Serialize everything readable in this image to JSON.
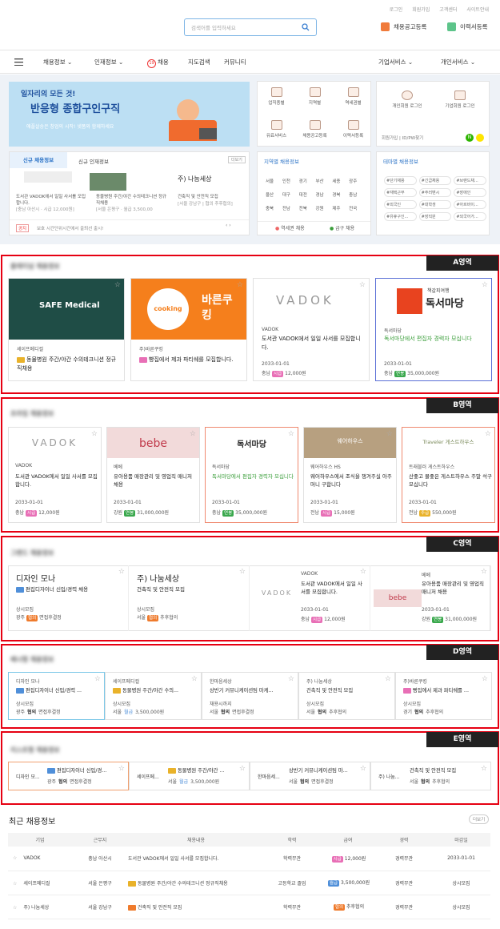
{
  "top_links": [
    "로그인",
    "회원가입",
    "고객센터",
    "사이트안내"
  ],
  "search": {
    "placeholder": "검색어를 입력하세요"
  },
  "header": {
    "post_job": "채용공고등록",
    "post_resume": "이력서등록"
  },
  "nav": {
    "items": [
      "채용정보",
      "인재정보",
      "채용",
      "지도검색",
      "커뮤니티"
    ],
    "badge": "19",
    "right": [
      "기업서비스",
      "개인서비스"
    ]
  },
  "banner": {
    "line1": "일자리의 모든 것!",
    "line2": "반응형 종합구인구직",
    "line3": "애플살송은 창업의 시작! 넷폼와 함께하세요"
  },
  "tiles": [
    "업직종별",
    "지역별",
    "역세권별",
    "유료서비스",
    "채용공고등록",
    "이력서등록"
  ],
  "login": {
    "personal": "개인회원 로그인",
    "company": "기업회원 로그인",
    "join": "회원가입",
    "find": "ID/PW찾기"
  },
  "new_info": {
    "tab1": "신규 채용정보",
    "tab2": "신규 인재정보",
    "more": "더보기",
    "items": [
      {
        "desc": "도서관 VADOK에서 일일 사서를 모집합니다.",
        "meta": "[충남 아산시 · 시급 12,000원]"
      },
      {
        "desc": "동물병원 주간/야간 수의테크니션 정규직채용",
        "meta": "[서울 은평구 · 월급 3,500,00"
      },
      {
        "name": "주) 나눔세상",
        "desc": "건축직 및 안전직 모집",
        "meta": "[서울 강남구 | 협의 추후협의]"
      }
    ],
    "notice_label": "공지",
    "notice": "보호 시간단위시간에서 출퇴선 출시!"
  },
  "region": {
    "title": "지역별 채용정보",
    "cities": [
      "서울",
      "인천",
      "경기",
      "부산",
      "세종",
      "광주",
      "울산",
      "대구",
      "대전",
      "경남",
      "경북",
      "충남",
      "충북",
      "전남",
      "전북",
      "강원",
      "제주",
      "전국"
    ],
    "subway": "역세권 채용",
    "urgent": "급구 채용"
  },
  "theme": {
    "title": "테마별 채용정보",
    "tags": [
      "#단기채용",
      "#긴급채용",
      "#브랜드채...",
      "#재택근무",
      "#주러벤시",
      "#장애인",
      "#외국인",
      "#대학생",
      "#아르바이...",
      "#유휴구인...",
      "#장직원",
      "#외국어가..."
    ]
  },
  "section_a": {
    "tag": "A영역",
    "title": "플래티넘 채용정보",
    "cards": [
      {
        "logo": "SAFE Medical",
        "company": "세이프메디컬",
        "title": "동물병원 주간/야간 수의테크니션 정규직채용"
      },
      {
        "logo": "cooking",
        "logo2": "바른쿠킹",
        "company": "주)바른쿠킹",
        "title": "빵집에서 제과 파티쉐를 모집합니다."
      },
      {
        "logo": "VADOK",
        "company": "VADOK",
        "title": "도서관 VADOK에서 일일 사서를 모집합니다.",
        "date": "2033-01-01",
        "region": "충남",
        "pay_type": "시급",
        "pay": "12,000원"
      },
      {
        "logo": "독서마당",
        "logo_small": "책갈피여행",
        "company": "독서마당",
        "title": "독서마당에서 편집자 경력자 모십니다",
        "date": "2033-01-01",
        "region": "충남",
        "pay_type": "연봉",
        "pay": "35,000,000원"
      }
    ]
  },
  "section_b": {
    "tag": "B영역",
    "title": "프라임 채용정보",
    "cards": [
      {
        "logo": "VADOK",
        "company": "VADOK",
        "title": "도서관 VADOK에서 일일 사서를 모집합니다.",
        "date": "2033-01-01",
        "region": "충남",
        "pay_type": "시급",
        "pay": "12,000원"
      },
      {
        "logo": "bebe",
        "company": "베베",
        "title": "유아용품 매장관리 및 영업직 매니저 채용",
        "date": "2033-01-01",
        "region": "강원",
        "pay_type": "연봉",
        "pay": "31,000,000원"
      },
      {
        "logo": "독서마당",
        "company": "독서마당",
        "title": "독서마당에서 편집자 경력자 모십니다",
        "date": "2033-01-01",
        "region": "충남",
        "pay_type": "연봉",
        "pay": "35,000,000원"
      },
      {
        "logo": "웨어하우스",
        "company": "웨어하우스 HS",
        "title": "웨어하우스에서 조식을 챙겨주실 아주머니 구합니다",
        "date": "2033-01-01",
        "region": "전남",
        "pay_type": "시급",
        "pay": "15,000원"
      },
      {
        "logo": "Traveler 게스트하우스",
        "company": "트래블러 게스트하우스",
        "title": "산좋고 물좋은 게스트하우스 주말 석구모십니다",
        "date": "2033-01-01",
        "region": "전남",
        "pay_type": "주급",
        "pay": "550,000원"
      }
    ]
  },
  "section_c": {
    "tag": "C영역",
    "title": "그랜드 채용정보",
    "cards": [
      {
        "company": "디자인 모나",
        "title": "편집디자이너 신입/경력 채용",
        "period": "상시모집",
        "region": "광주",
        "pay_type": "협의",
        "pay": "면접후결정"
      },
      {
        "company": "주) 나눔세상",
        "title": "건축직 및 안전직 모집",
        "period": "상시모집",
        "region": "서울",
        "pay_type": "협의",
        "pay": "추후협의"
      },
      {
        "logo": "VADOK",
        "company": "VADOK",
        "title": "도서관 VADOK에서 일일 사서를 모집합니다.",
        "date": "2033-01-01",
        "region": "충남",
        "pay_type": "시급",
        "pay": "12,000원"
      },
      {
        "logo": "bebe",
        "company": "베베",
        "title": "유아용품 매장관리 및 영업직 매니저 채용",
        "date": "2033-01-01",
        "region": "강원",
        "pay_type": "연봉",
        "pay": "31,000,000원"
      }
    ]
  },
  "section_d": {
    "tag": "D영역",
    "title": "배너형 채용정보",
    "cards": [
      {
        "company": "디자인 모나",
        "title": "편집디자이너 신입/경력 ...",
        "period": "상시모집",
        "region": "광주",
        "pay_type": "협의",
        "pay": "면접후결정"
      },
      {
        "company": "세이프메디컬",
        "title": "동물병원 주간/야간 수의...",
        "period": "상시모집",
        "region": "서울",
        "pay_type": "월급",
        "pay": "3,500,000원"
      },
      {
        "company": "한마음세상",
        "title": "상반기 커뮤니케이션팀 마케...",
        "period": "채용시까지",
        "region": "서울",
        "pay_type": "협의",
        "pay": "면접후결정"
      },
      {
        "company": "주) 나눔세상",
        "title": "건축직 및 안전직 모집",
        "period": "상시모집",
        "region": "서울",
        "pay_type": "협의",
        "pay": "추후협의"
      },
      {
        "company": "주)바른쿠킹",
        "title": "빵집에서 제과 파티쉐를 ...",
        "period": "상시모집",
        "region": "경기",
        "pay_type": "협의",
        "pay": "추후협의"
      }
    ]
  },
  "section_e": {
    "tag": "E영역",
    "title": "리스트형 채용정보",
    "cards": [
      {
        "company": "디자인 모...",
        "title": "편집디자이너 신입/경...",
        "region": "광주",
        "pay_type": "협의",
        "pay": "면접후결정"
      },
      {
        "company": "세이프메...",
        "title": "동물병원 주간/야간 ...",
        "region": "서울",
        "pay_type": "월급",
        "pay": "3,500,000원"
      },
      {
        "company": "한마음세...",
        "title": "상반기 커뮤니케이션팀 마...",
        "region": "서울",
        "pay_type": "협의",
        "pay": "면접후결정"
      },
      {
        "company": "주) 나눔...",
        "title": "건축직 및 안전직 모집",
        "region": "서울",
        "pay_type": "협의",
        "pay": "추후협의"
      }
    ]
  },
  "recent": {
    "title": "최근 채용정보",
    "more": "더보기",
    "headers": [
      "기업",
      "근무지",
      "채용내용",
      "학력",
      "급여",
      "경력",
      "마감일"
    ],
    "rows": [
      {
        "company": "VADOK",
        "location": "충남 아산시",
        "content": "도서관 VADOK에서 일일 사서를 모집합니다.",
        "edu": "학력무관",
        "pay_type": "시급",
        "pay": "12,000원",
        "career": "경력무관",
        "deadline": "2033-01-01"
      },
      {
        "company": "세이프메디컬",
        "location": "서울 은평구",
        "content": "동물병원 주간/야간 수의테크니션 정규직채용",
        "edu": "고등학교 졸업",
        "pay_type": "월급",
        "pay": "3,500,000원",
        "career": "경력무관",
        "deadline": "상시모집"
      },
      {
        "company": "주) 나눔세상",
        "location": "서울 강남구",
        "content": "건축직 및 안전직 모집",
        "edu": "학력무관",
        "pay_type": "협의",
        "pay": "추후협의",
        "career": "경력무관",
        "deadline": "상시모집"
      }
    ]
  }
}
